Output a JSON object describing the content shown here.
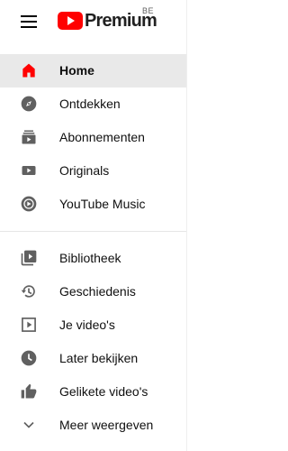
{
  "header": {
    "menu_icon": "hamburger-menu-icon",
    "logo_text": "Premium",
    "region": "BE"
  },
  "colors": {
    "accent": "#ff0000",
    "active_bg": "#e9e9e9",
    "icon": "#606060"
  },
  "primary_nav": [
    {
      "label": "Home",
      "icon": "home-icon",
      "active": true
    },
    {
      "label": "Ontdekken",
      "icon": "compass-icon"
    },
    {
      "label": "Abonnementen",
      "icon": "subscriptions-icon"
    },
    {
      "label": "Originals",
      "icon": "originals-icon"
    },
    {
      "label": "YouTube Music",
      "icon": "youtube-music-icon"
    }
  ],
  "library_nav": [
    {
      "label": "Bibliotheek",
      "icon": "library-icon"
    },
    {
      "label": "Geschiedenis",
      "icon": "history-icon"
    },
    {
      "label": "Je video's",
      "icon": "your-videos-icon"
    },
    {
      "label": "Later bekijken",
      "icon": "watch-later-icon"
    },
    {
      "label": "Gelikete video's",
      "icon": "liked-videos-icon"
    },
    {
      "label": "Meer weergeven",
      "icon": "chevron-down-icon"
    }
  ]
}
